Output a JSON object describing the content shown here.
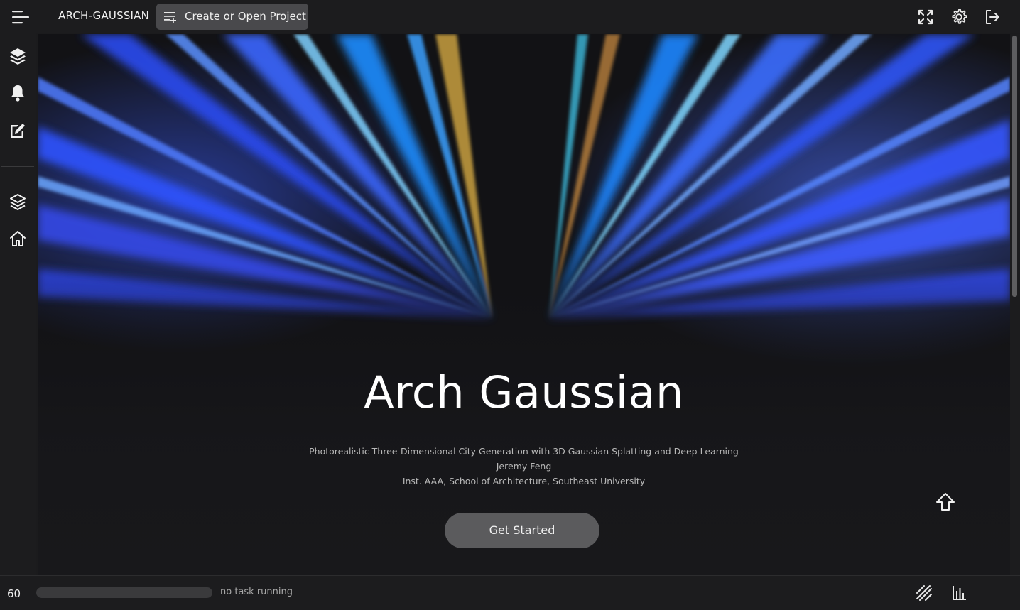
{
  "header": {
    "app_title": "ARCH-GAUSSIAN",
    "project_button_label": "Create or Open Project",
    "icons": [
      "menu-icon",
      "playlist-add-icon",
      "fullscreen-icon",
      "gear-icon",
      "logout-icon"
    ]
  },
  "sidebar": {
    "items": [
      {
        "name": "layers",
        "icon": "layers-icon"
      },
      {
        "name": "notifications",
        "icon": "bell-icon"
      },
      {
        "name": "edit",
        "icon": "edit-icon"
      },
      {
        "name": "layers-secondary",
        "icon": "layers-outline-icon"
      },
      {
        "name": "home",
        "icon": "home-icon"
      }
    ]
  },
  "hero": {
    "title": "Arch Gaussian",
    "subtitle": "Photorealistic Three-Dimensional City Generation with 3D Gaussian Splatting and Deep Learning",
    "author": "Jeremy Feng",
    "affiliation": "Inst. AAA, School of Architecture, Southeast University",
    "cta_label": "Get Started",
    "scroll_top_icon": "arrow-up-icon"
  },
  "statusbar": {
    "fps": "60",
    "progress": 0,
    "task_status": "no task running",
    "icons": [
      "diagonal-lines-icon",
      "bar-chart-icon"
    ]
  }
}
